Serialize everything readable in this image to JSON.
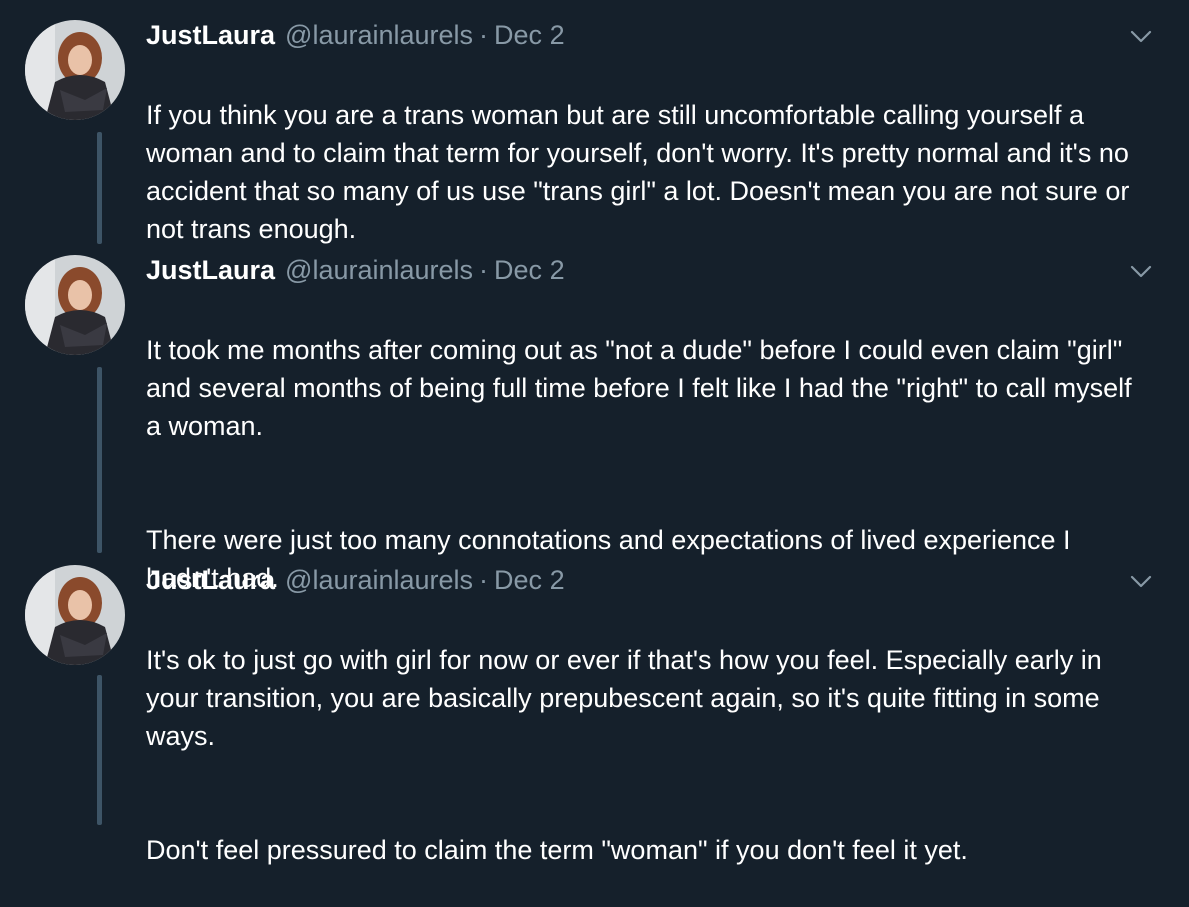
{
  "theme": {
    "background": "#15202b",
    "text": "#ffffff",
    "secondary_text": "#8899a6",
    "thread_line": "#3d5466"
  },
  "tweets": [
    {
      "display_name": "JustLaura",
      "handle": "@laurainlaurels",
      "separator": "·",
      "date": "Dec 2",
      "paragraphs": [
        "If you think you are a trans woman but are still uncomfortable calling yourself a woman and to claim that term for yourself, don't worry. It's pretty normal and it's no accident that so many of us use \"trans girl\" a lot. Doesn't mean you are not sure or not trans enough."
      ],
      "avatar_icon": "profile-photo",
      "menu_icon": "chevron-down-icon"
    },
    {
      "display_name": "JustLaura",
      "handle": "@laurainlaurels",
      "separator": "·",
      "date": "Dec 2",
      "paragraphs": [
        "It took me months after coming out as \"not a dude\" before I could even claim \"girl\" and several months of being full time before I felt like I had the \"right\" to call myself a woman.",
        "There were just too many connotations and expectations of lived experience I hadn't had."
      ],
      "avatar_icon": "profile-photo",
      "menu_icon": "chevron-down-icon"
    },
    {
      "display_name": "JustLaura",
      "handle": "@laurainlaurels",
      "separator": "·",
      "date": "Dec 2",
      "paragraphs": [
        "It's ok to just go with girl for now or ever if that's how you feel. Especially early in your transition, you are basically prepubescent again, so it's quite fitting in some ways.",
        "Don't feel pressured to claim the term \"woman\" if you don't feel it yet."
      ],
      "avatar_icon": "profile-photo",
      "menu_icon": "chevron-down-icon"
    }
  ]
}
